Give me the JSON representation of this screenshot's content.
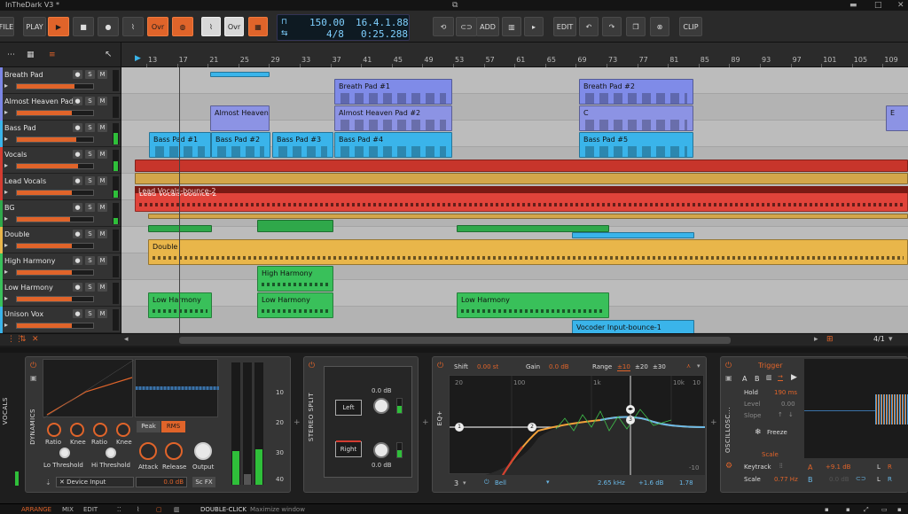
{
  "window": {
    "title": "InTheDark V3 *"
  },
  "transport": {
    "file_label": "FILE",
    "play_label": "PLAY",
    "ovr1_label": "Ovr",
    "ovr2_label": "Ovr",
    "tempo": "150.00",
    "signature": "4/8",
    "position": "16.4.1.88",
    "time": "0:25.288",
    "add_label": "ADD",
    "edit_label": "EDIT",
    "clip_label": "CLIP"
  },
  "ruler": {
    "bars": [
      "13",
      "17",
      "21",
      "25",
      "29",
      "33",
      "37",
      "41",
      "45",
      "49",
      "53",
      "57",
      "61",
      "65",
      "69",
      "73",
      "77",
      "81",
      "85",
      "89",
      "93",
      "97",
      "101",
      "105",
      "109"
    ]
  },
  "tracks": [
    {
      "name": "Breath Pad",
      "color": "#7b86e6",
      "fader": 0.75,
      "meter": 0.0
    },
    {
      "name": "Almost Heaven Pad",
      "color": "#7b86e6",
      "fader": 0.72,
      "meter": 0.0
    },
    {
      "name": "Bass Pad",
      "color": "#3ab4ea",
      "fader": 0.78,
      "meter": 0.55
    },
    {
      "name": "Vocals",
      "color": "#d43c30",
      "fader": 0.8,
      "meter": 0.45
    },
    {
      "name": "Lead Vocals",
      "color": "#d43c30",
      "fader": 0.72,
      "meter": 0.35
    },
    {
      "name": "BG",
      "color": "#2fa84a",
      "fader": 0.7,
      "meter": 0.3
    },
    {
      "name": "Double",
      "color": "#e9b64a",
      "fader": 0.72,
      "meter": 0.0
    },
    {
      "name": "High Harmony",
      "color": "#39c05a",
      "fader": 0.72,
      "meter": 0.0
    },
    {
      "name": "Low Harmony",
      "color": "#39c05a",
      "fader": 0.72,
      "meter": 0.0
    },
    {
      "name": "Unison Vox",
      "color": "#3ab4ea",
      "fader": 0.72,
      "meter": 0.0
    }
  ],
  "track_buttons": {
    "m": "M",
    "s": "S"
  },
  "clips": {
    "breath": [
      "Breath Pad #1",
      "Breath Pad #2"
    ],
    "heaven": [
      "Almost Heaven Pa",
      "Almost Heaven Pad #2",
      "C",
      "E"
    ],
    "bass": [
      "Bass Pad #1",
      "Bass Pad #2",
      "Bass Pad #3",
      "Bass Pad #4",
      "Bass Pad #5"
    ],
    "lead": "Lead Vocals-bounce-2",
    "double": "Double",
    "high": "High Harmony",
    "low": [
      "Low Harmony",
      "Low Harmony",
      "Low Harmony"
    ],
    "unison": "Vocoder Input-bounce-1"
  },
  "scroll": {
    "zoom": "4/1"
  },
  "devices": {
    "chain_label": "VOCALS",
    "dynamics": {
      "title": "DYNAMICS",
      "knobs": [
        "Ratio",
        "Knee",
        "Ratio",
        "Knee",
        "Lo Threshold",
        "Hi Threshold",
        "Attack",
        "Release",
        "Output"
      ],
      "peak": "Peak",
      "rms": "RMS",
      "sidechain": "Device Input",
      "db": "0.0 dB",
      "scfx": "Sc FX",
      "meter_scale": [
        "10",
        "20",
        "30",
        "40"
      ]
    },
    "split": {
      "title": "STEREO SPLIT",
      "left": "Left",
      "right": "Right",
      "left_db": "0.0 dB",
      "right_db": "0.0 dB"
    },
    "eq": {
      "title": "EQ+",
      "shift_label": "Shift",
      "shift_val": "0.00 st",
      "gain_label": "Gain",
      "gain_val": "0.0 dB",
      "range_label": "Range",
      "ranges": [
        "±10",
        "±20",
        "±30"
      ],
      "freq_ticks": [
        "20",
        "100",
        "1k",
        "10k"
      ],
      "db_ticks": [
        "10",
        "-10"
      ],
      "band": "3",
      "type": "Bell",
      "freq": "2.65 kHz",
      "gain": "+1.6 dB",
      "q": "1.78"
    },
    "osc": {
      "title": "OSCILLOSC...",
      "trigger": "Trigger",
      "abs": [
        "A",
        "B"
      ],
      "hold_label": "Hold",
      "hold_val": "190 ms",
      "level_label": "Level",
      "level_val": "0.00",
      "slope_label": "Slope",
      "freeze": "Freeze",
      "scale_title": "Scale",
      "keytrack_label": "Keytrack",
      "scale_label": "Scale",
      "scale_val": "0.77 Hz",
      "a_label": "A",
      "a_db": "+9.1 dB",
      "b_label": "B",
      "b_db": "0.0 dB",
      "lr": [
        "L",
        "R",
        "L",
        "R"
      ]
    }
  },
  "status": {
    "arrange": "ARRANGE",
    "mix": "MIX",
    "edit": "EDIT",
    "hint_key": "DOUBLE-CLICK",
    "hint": "Maximize window"
  }
}
